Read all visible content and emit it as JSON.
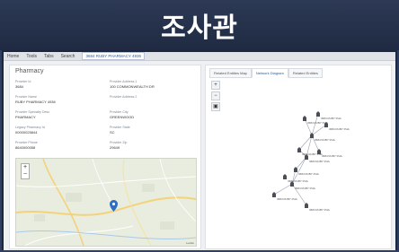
{
  "banner": {
    "title": "조사관"
  },
  "menubar": {
    "items": [
      "Home",
      "Tools",
      "Tabs",
      "Search"
    ],
    "tab_label": "3684 RUBY PHARMACY 4936"
  },
  "panel": {
    "title": "Pharmacy"
  },
  "fields": [
    {
      "label": "Provider Id",
      "value": "3684"
    },
    {
      "label": "Provider Address 1",
      "value": "100 COMMONWEALTH DR"
    },
    {
      "label": "Provider Name",
      "value": "RUBY PHARMACY 4936"
    },
    {
      "label": "Provider Address 2",
      "value": ""
    },
    {
      "label": "Provider Specialty Desc",
      "value": "PHARMACY"
    },
    {
      "label": "Provider City",
      "value": "GREENWOOD"
    },
    {
      "label": "Legacy Pharmacy Id",
      "value": "00000025844"
    },
    {
      "label": "Provider State",
      "value": "SC"
    },
    {
      "label": "Provider Phone",
      "value": "8640000058"
    },
    {
      "label": "Provider Zip",
      "value": "29649"
    }
  ],
  "map": {
    "credit": "Leaflet",
    "zoom_in": "+",
    "zoom_out": "−"
  },
  "tabs": [
    "Related Entities Map",
    "Network Diagram",
    "Related Entities"
  ],
  "active_tab_index": 1,
  "graph_tools": [
    "zoom-in-icon",
    "zoom-out-icon",
    "fit-icon"
  ],
  "graph_nodes": [
    {
      "id": "n1",
      "label": "3684 RUBY PHA"
    },
    {
      "id": "n2",
      "label": "3684 RUBY PHA"
    },
    {
      "id": "n3",
      "label": "3684 RUBY PHA"
    },
    {
      "id": "n4",
      "label": "3684 RUBY PHA"
    },
    {
      "id": "n5",
      "label": "3684 RUBY PHA"
    },
    {
      "id": "n6",
      "label": "3684 RUBY PHA"
    },
    {
      "id": "n7",
      "label": "3684 RUBY PHA"
    },
    {
      "id": "n8",
      "label": "3684 RUBY PHA"
    },
    {
      "id": "n9",
      "label": "3684 RUBY PHA"
    },
    {
      "id": "n10",
      "label": "3684 RUBY PHA"
    },
    {
      "id": "n11",
      "label": "3684 RUBY PHA"
    },
    {
      "id": "n12",
      "label": "3684 RUBY PHA"
    }
  ],
  "colors": {
    "banner": "#2d3a55",
    "accent": "#2b5fa3",
    "map_pin": "#2d6fc4"
  }
}
